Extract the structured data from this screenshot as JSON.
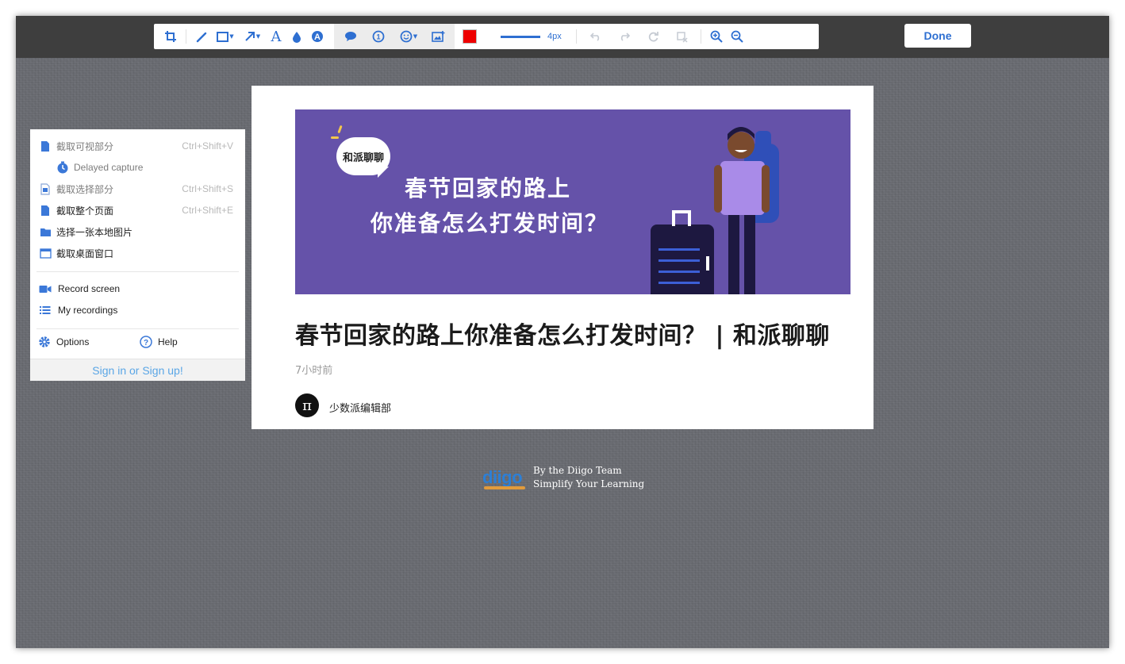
{
  "toolbar": {
    "tools": [
      "crop-tool",
      "pen-tool",
      "rectangle-tool",
      "arrow-tool",
      "text-tool",
      "blur-tool",
      "highlight-text-tool"
    ],
    "grey_group": [
      "speech-bubble-tool",
      "number-stamp-tool",
      "emoji-tool",
      "image-tool"
    ],
    "color": "#ee0000",
    "stroke_label": "4px",
    "history": [
      "undo",
      "redo",
      "reset",
      "clear"
    ],
    "zoom": [
      "zoom-in",
      "zoom-out"
    ],
    "done_label": "Done"
  },
  "menu": {
    "items": [
      {
        "label": "截取可视部分",
        "shortcut": "Ctrl+Shift+V"
      },
      {
        "label": "Delayed capture",
        "shortcut": ""
      },
      {
        "label": "截取选择部分",
        "shortcut": "Ctrl+Shift+S"
      },
      {
        "label": "截取整个页面",
        "shortcut": "Ctrl+Shift+E"
      },
      {
        "label": "选择一张本地图片",
        "shortcut": ""
      },
      {
        "label": "截取桌面窗口",
        "shortcut": ""
      }
    ],
    "record_label": "Record screen",
    "recordings_label": "My recordings",
    "options_label": "Options",
    "help_label": "Help",
    "signin_label": "Sign in or Sign up!"
  },
  "article": {
    "banner_bubble": "和派聊聊",
    "banner_line1": "春节回家的路上",
    "banner_line2": "你准备怎么打发时间？",
    "title": "春节回家的路上你准备怎么打发时间？ | 和派聊聊",
    "time": "7小时前",
    "avatar_glyph": "π",
    "author": "少数派编辑部"
  },
  "brand": {
    "logo": "diigo",
    "line1": "By the Diigo Team",
    "line2": "Simplify Your Learning"
  },
  "colors": {
    "accent": "#2e6fd1",
    "banner": "#6552a9",
    "topbar": "#3e3e3e",
    "signin": "#5aa6e6"
  }
}
